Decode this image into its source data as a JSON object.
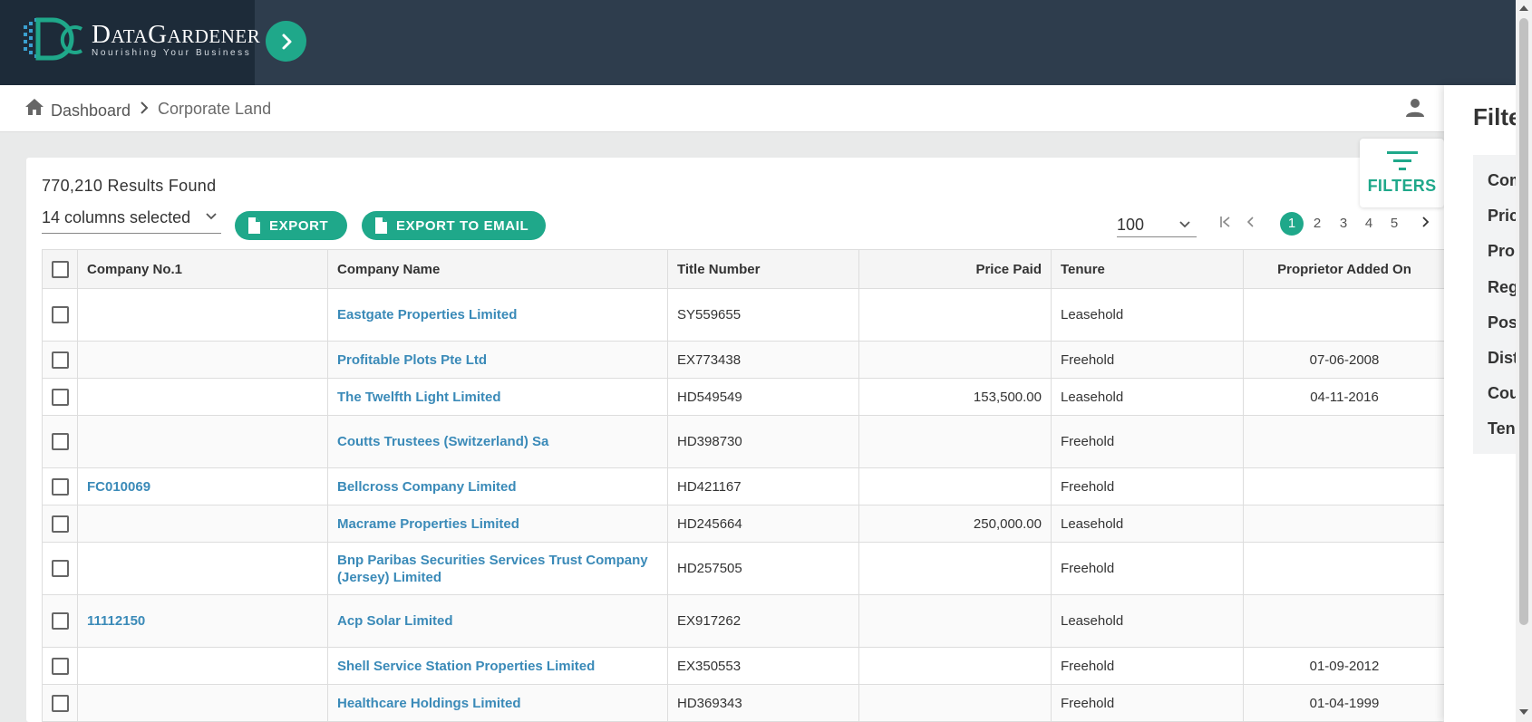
{
  "brand": {
    "name": "DataGardener",
    "name_big1": "D",
    "name_small1": "ATA",
    "name_big2": "G",
    "name_small2": "ARDENER",
    "tagline": "Nourishing Your Business"
  },
  "breadcrumb": {
    "home": "Dashboard",
    "current": "Corporate Land"
  },
  "results": {
    "count_text": "770,210 Results Found"
  },
  "toolbar": {
    "columns_selected": "14 columns selected",
    "export_label": "EXPORT",
    "export_email_label": "EXPORT TO EMAIL"
  },
  "pagination": {
    "page_size": "100",
    "pages": [
      "1",
      "2",
      "3",
      "4",
      "5"
    ],
    "current": "1"
  },
  "filters_tab": {
    "label": "FILTERS"
  },
  "filter_panel": {
    "title": "Filters",
    "items": [
      "Company",
      "Price Paid",
      "Proprietor",
      "Region",
      "Postcode",
      "District",
      "County",
      "Tenure"
    ]
  },
  "table": {
    "columns": [
      "Company No.1",
      "Company Name",
      "Title Number",
      "Price Paid",
      "Tenure",
      "Proprietor Added On"
    ],
    "rows": [
      {
        "company_no": "",
        "name": "Eastgate Properties Limited",
        "title": "SY559655",
        "price": "",
        "tenure": "Leasehold",
        "added": ""
      },
      {
        "company_no": "",
        "name": "Profitable Plots Pte Ltd",
        "title": "EX773438",
        "price": "",
        "tenure": "Freehold",
        "added": "07-06-2008"
      },
      {
        "company_no": "",
        "name": "The Twelfth Light Limited",
        "title": "HD549549",
        "price": "153,500.00",
        "tenure": "Leasehold",
        "added": "04-11-2016"
      },
      {
        "company_no": "",
        "name": "Coutts Trustees (Switzerland) Sa",
        "title": "HD398730",
        "price": "",
        "tenure": "Freehold",
        "added": ""
      },
      {
        "company_no": "FC010069",
        "name": "Bellcross Company Limited",
        "title": "HD421167",
        "price": "",
        "tenure": "Freehold",
        "added": ""
      },
      {
        "company_no": "",
        "name": "Macrame Properties Limited",
        "title": "HD245664",
        "price": "250,000.00",
        "tenure": "Leasehold",
        "added": ""
      },
      {
        "company_no": "",
        "name": "Bnp Paribas Securities Services Trust Company (Jersey) Limited",
        "title": "HD257505",
        "price": "",
        "tenure": "Freehold",
        "added": ""
      },
      {
        "company_no": "11112150",
        "name": "Acp Solar Limited",
        "title": "EX917262",
        "price": "",
        "tenure": "Leasehold",
        "added": ""
      },
      {
        "company_no": "",
        "name": "Shell Service Station Properties Limited",
        "title": "EX350553",
        "price": "",
        "tenure": "Freehold",
        "added": "01-09-2012"
      },
      {
        "company_no": "",
        "name": "Healthcare Holdings Limited",
        "title": "HD369343",
        "price": "",
        "tenure": "Freehold",
        "added": "01-04-1999"
      }
    ]
  },
  "colors": {
    "accent": "#1fa88a",
    "header_bg": "#2e3d4d",
    "link": "#3a8ab8"
  }
}
